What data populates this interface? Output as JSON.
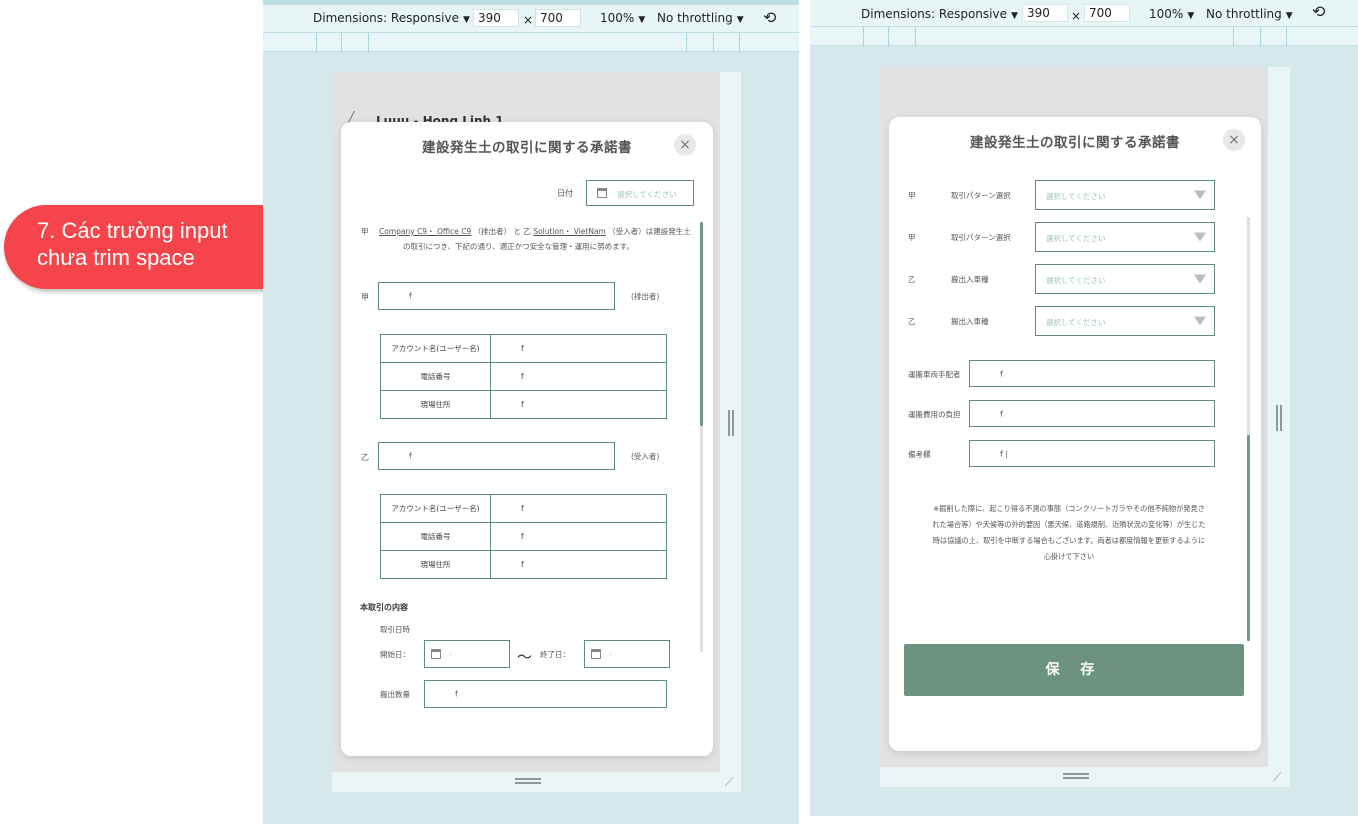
{
  "annotation": {
    "line1": "7. Các trường input",
    "line2": "chưa trim space",
    "color": "#f6454a"
  },
  "devtools": {
    "dimensions_label": "Dimensions: Responsive",
    "width": "390",
    "x": "×",
    "height": "700",
    "zoom": "100%",
    "throttling": "No throttling",
    "rotate_icon": "rotate-icon"
  },
  "left": {
    "bg_header": "Luuu - Hong Linh 1",
    "title": "建設発生土の取引に関する承諾書",
    "close": "×",
    "date_label": "日付",
    "date_placeholder": "選択してください",
    "party_a_mark": "甲",
    "company_a": "Company C9・ Office C9",
    "role_a_paren": "（排出者）",
    "and_b": "と 乙",
    "company_b": "Solution・ VietNam",
    "role_b_paren": "（受入者）は建設発生土",
    "agreement_line2": "の取引につき、下記の通り、適正かつ安全な管理・運用に努めます。",
    "party_a_label": "甲",
    "party_a_value": "f",
    "party_a_role": "(排出者)",
    "table_a": [
      {
        "k": "アカウント名(ユーザー名)",
        "v": "f"
      },
      {
        "k": "電話番号",
        "v": "f"
      },
      {
        "k": "現場住所",
        "v": "f"
      }
    ],
    "party_b_label": "乙",
    "party_b_value": "f",
    "party_b_role": "(受入者)",
    "table_b": [
      {
        "k": "アカウント名(ユーザー名)",
        "v": "f"
      },
      {
        "k": "電話番号",
        "v": "f"
      },
      {
        "k": "現場住所",
        "v": "f"
      }
    ],
    "section_title": "本取引の内容",
    "trade_date_label": "取引日時",
    "start_label": "開始日：",
    "start_placeholder": "-",
    "tilde": "〜",
    "end_label": "終了日：",
    "end_placeholder": "-",
    "quantity_label": "搬出数量",
    "quantity_value": "f"
  },
  "right": {
    "title": "建設発生土の取引に関する承諾書",
    "close": "×",
    "selects": [
      {
        "mark": "甲",
        "label": "取引パターン選択",
        "placeholder": "選択してください"
      },
      {
        "mark": "甲",
        "label": "取引パターン選択",
        "placeholder": "選択してください"
      },
      {
        "mark": "乙",
        "label": "搬出入車種",
        "placeholder": "選択してください"
      },
      {
        "mark": "乙",
        "label": "搬出入車種",
        "placeholder": "選択してください"
      }
    ],
    "fields": [
      {
        "label": "運搬車両手配者",
        "value": "f"
      },
      {
        "label": "運搬費用の負担",
        "value": "f"
      },
      {
        "label": "備考欄",
        "value": "f |"
      }
    ],
    "note": [
      "※掘削した際に、起こり得る不測の事態（コンクリートガラやその他不純物が発見さ",
      "れた場合等）や天候等の外的要因（悪天候、道路規制、近隣状況の変化等）が生じた",
      "時は協議の上、取引を中断する場合もございます。両者は都度情報を更新するように",
      "心掛けて下さい"
    ],
    "save": "保 存",
    "accent": "#6b9380"
  }
}
